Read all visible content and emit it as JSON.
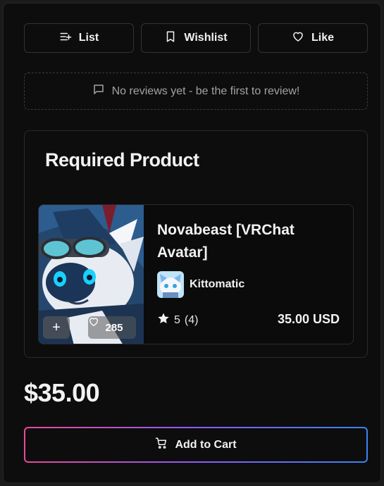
{
  "actions": {
    "list_label": "List",
    "wishlist_label": "Wishlist",
    "like_label": "Like"
  },
  "reviews": {
    "empty_text": "No reviews yet - be the first to review!"
  },
  "required_product": {
    "heading": "Required Product",
    "name": "Novabeast [VRChat Avatar]",
    "creator": "Kittomatic",
    "rating": "5",
    "rating_count": "(4)",
    "price": "35.00 USD",
    "favorites": "285",
    "add_icon": "+"
  },
  "price": "$35.00",
  "cart": {
    "label": "Add to Cart"
  },
  "colors": {
    "gradient_start": "#ec4899",
    "gradient_end": "#3b82f6"
  }
}
